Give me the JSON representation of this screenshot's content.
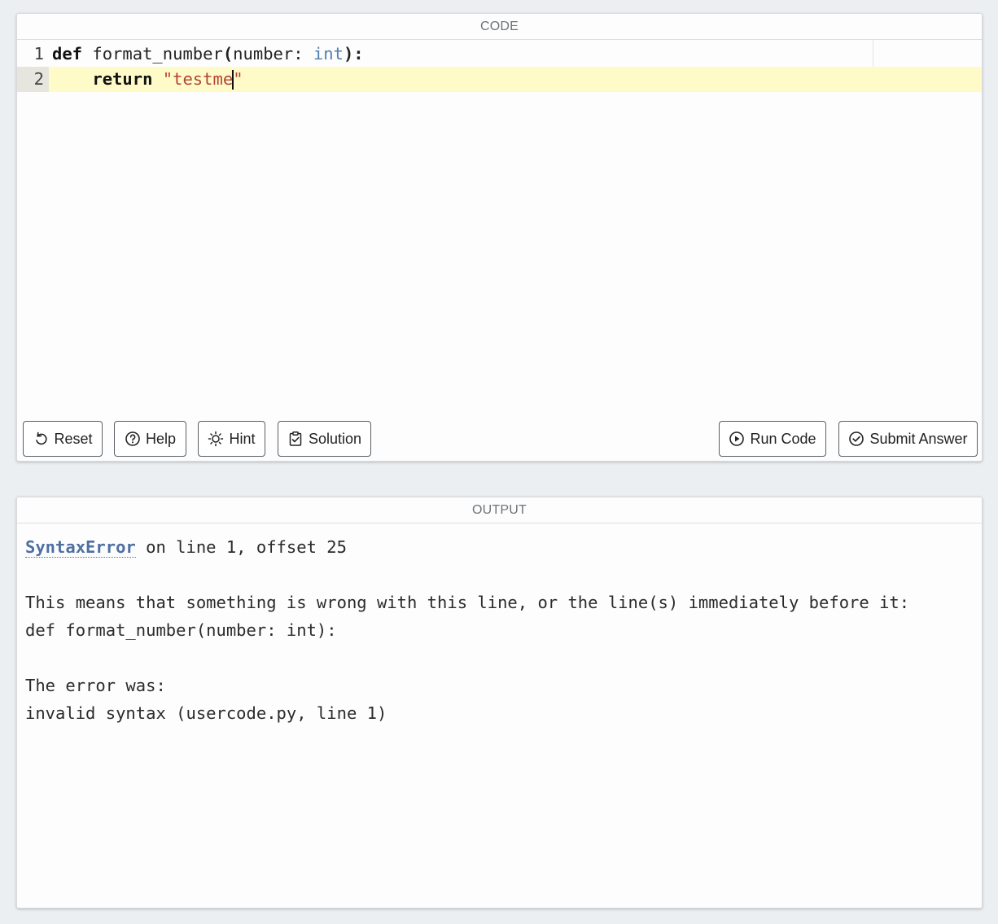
{
  "code_panel": {
    "header": "CODE",
    "lines": [
      {
        "number": "1"
      },
      {
        "number": "2"
      }
    ],
    "line1": {
      "kw_def": "def",
      "func": " format_number",
      "open_paren": "(",
      "param": "number: ",
      "type": "int",
      "close": "):"
    },
    "line2": {
      "indent": "    ",
      "kw_return": "return",
      "space": " ",
      "str_before_cursor": "\"testme",
      "str_after_cursor": "\""
    }
  },
  "buttons": {
    "reset": {
      "label": "Reset",
      "icon": "undo-icon"
    },
    "help": {
      "label": "Help",
      "icon": "question-circle-icon"
    },
    "hint": {
      "label": "Hint",
      "icon": "lightbulb-sun-icon"
    },
    "solution": {
      "label": "Solution",
      "icon": "clipboard-check-icon"
    },
    "run": {
      "label": "Run Code",
      "icon": "play-circle-icon"
    },
    "submit": {
      "label": "Submit Answer",
      "icon": "check-circle-icon"
    }
  },
  "output_panel": {
    "header": "OUTPUT",
    "error_name": "SyntaxError",
    "error_location": " on line 1, offset 25",
    "explanation": "This means that something is wrong with this line, or the line(s) immediately before it:",
    "offending_line": "def format_number(number: int):",
    "error_was_label": "The error was:",
    "error_message": "invalid syntax (usercode.py, line 1)"
  },
  "colors": {
    "background": "#eceff2",
    "current_line": "#fffbc9",
    "keyword_builtin": "#4f80b3",
    "string": "#b2443a",
    "error_link": "#4f6fa3"
  }
}
